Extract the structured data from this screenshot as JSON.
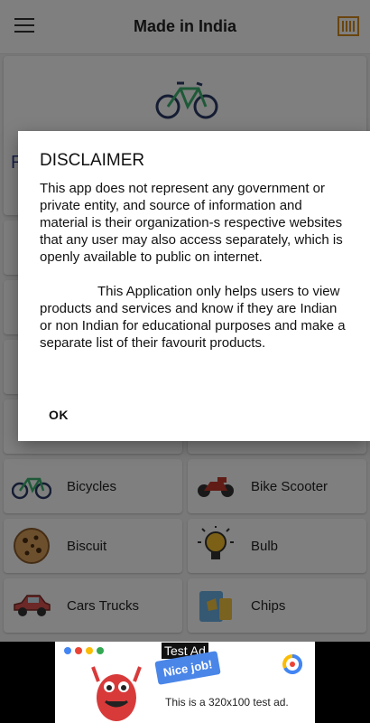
{
  "appbar": {
    "title": "Made in India",
    "menu_icon": "hamburger-menu-icon",
    "barcode_icon": "barcode-scanner-icon"
  },
  "hero": {
    "label_fragment": "R",
    "icon": "bicycle-icon"
  },
  "categories": [
    {
      "label": "Bicycles",
      "icon": "bicycle-icon"
    },
    {
      "label": "Bike Scooter",
      "icon": "motorbike-icon"
    },
    {
      "label": "Biscuit",
      "icon": "cookie-icon"
    },
    {
      "label": "Bulb",
      "icon": "lightbulb-icon"
    },
    {
      "label": "Cars Trucks",
      "icon": "car-icon"
    },
    {
      "label": "Chips",
      "icon": "chips-icon"
    }
  ],
  "dialog": {
    "title": "DISCLAIMER",
    "paragraph1": "This app does not represent any government or private entity, and source of information and material is their organization-s respective websites that any user may also access separately, which is openly available to public on internet.",
    "paragraph2": "This Application only helps users to view products and services and know if they are Indian or non Indian for educational purposes and make a separate list of their favourit products.",
    "ok_label": "OK"
  },
  "ad": {
    "tag": "Test Ad",
    "badge": "Nice job!",
    "text": "This is a 320x100 test ad."
  },
  "colors": {
    "accent": "#2c3e8f",
    "barcode": "#d38a1e",
    "bike_red": "#c0392b"
  }
}
